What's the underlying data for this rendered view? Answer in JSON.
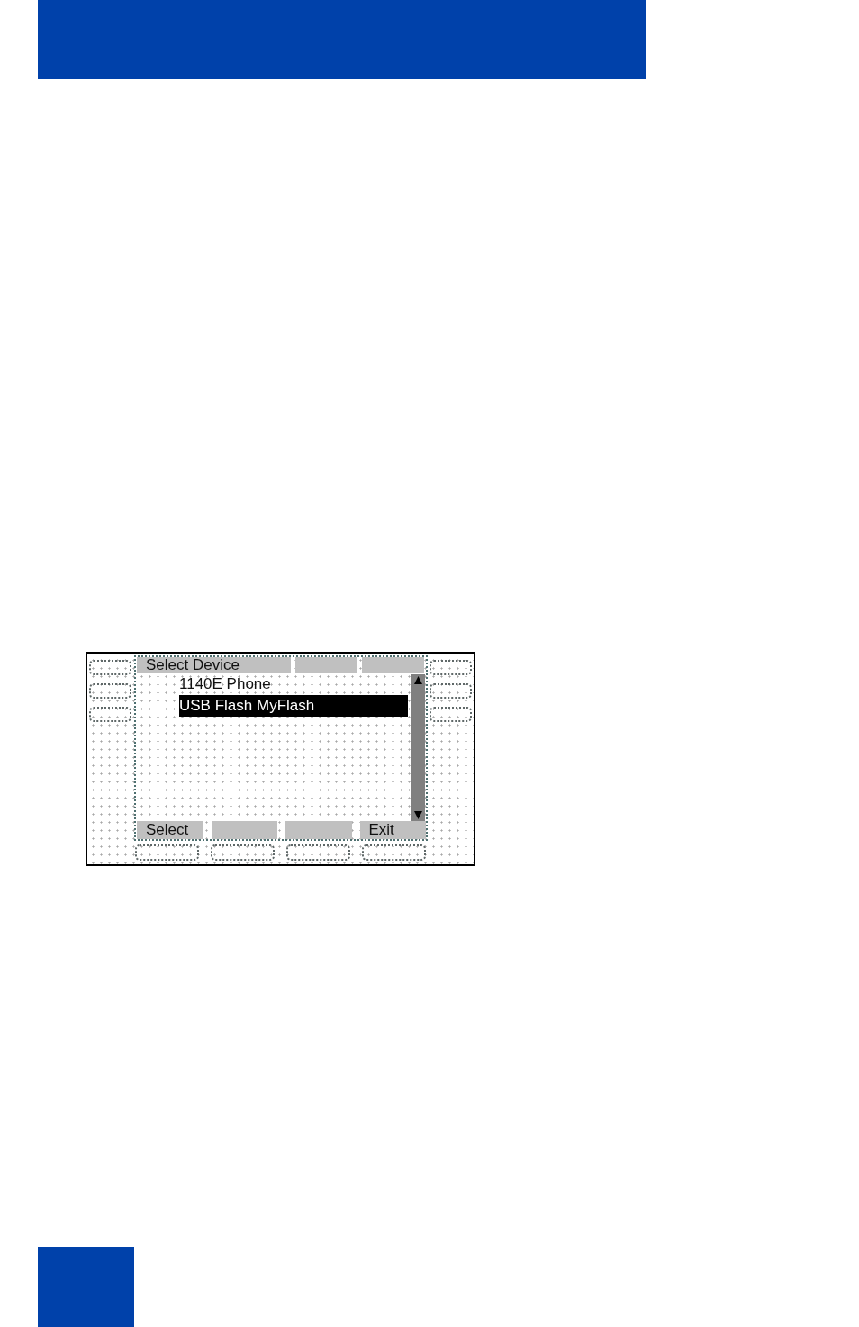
{
  "display": {
    "title": "Select Device",
    "items": [
      {
        "label": "1140E Phone",
        "selected": false
      },
      {
        "label": "USB Flash MyFlash",
        "selected": true
      }
    ],
    "softkeys": [
      {
        "kind": "label",
        "label": "Select"
      },
      {
        "kind": "blank"
      },
      {
        "kind": "blank"
      },
      {
        "kind": "label",
        "label": "Exit"
      }
    ]
  }
}
